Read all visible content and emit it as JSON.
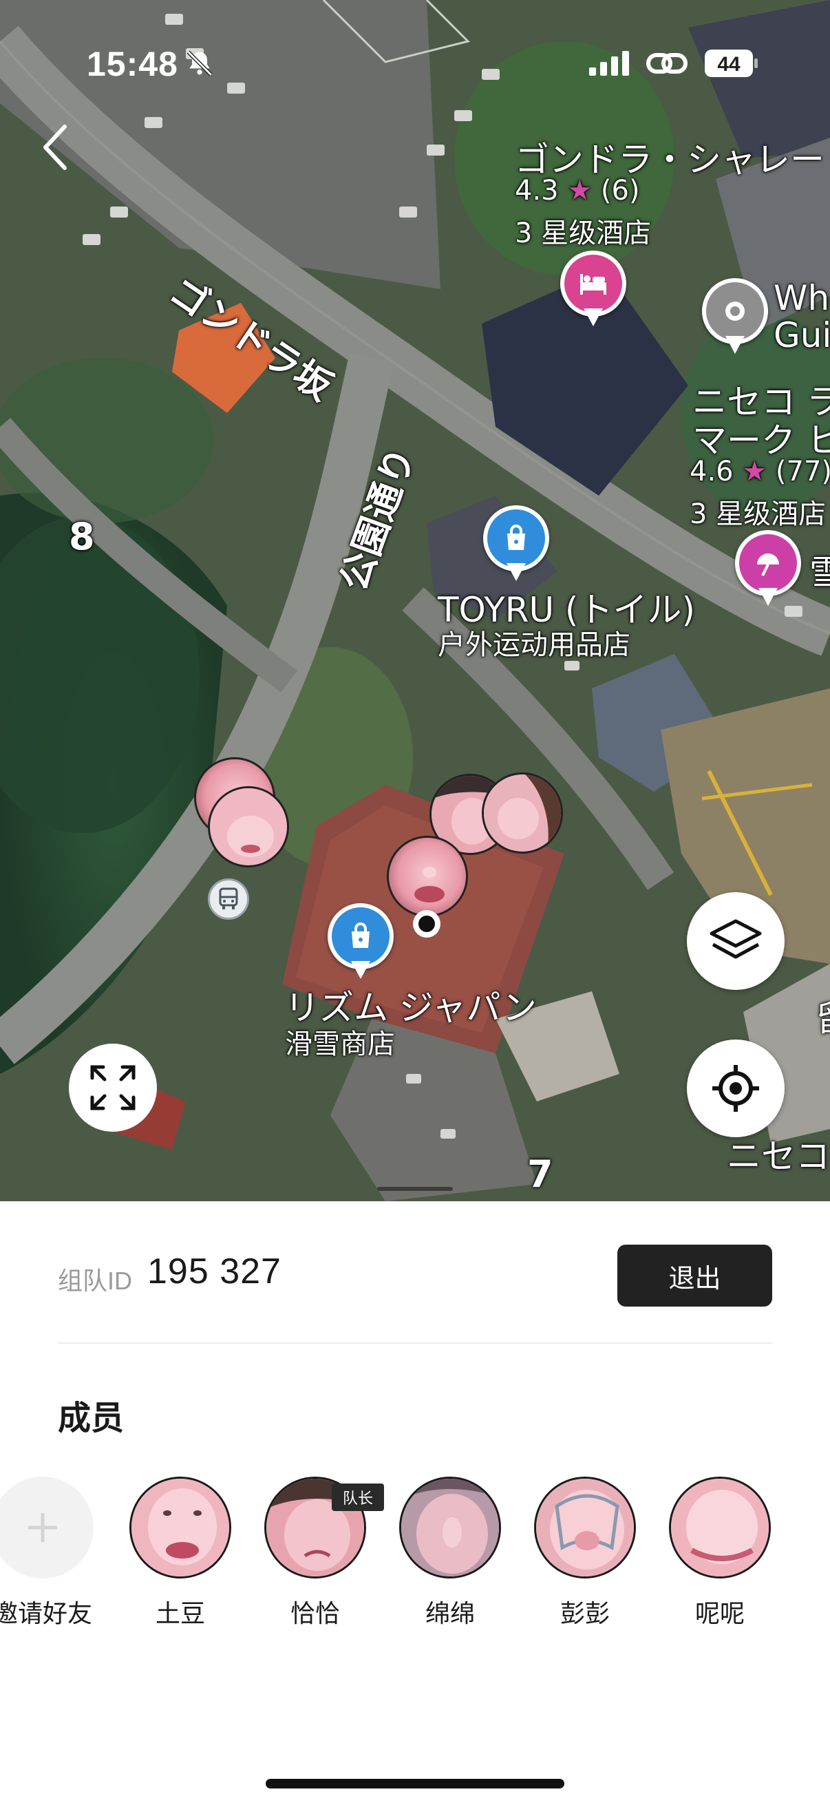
{
  "status_bar": {
    "time": "15:48",
    "battery": "44"
  },
  "map": {
    "labels": {
      "gondola_chalet": "ゴンドラ・シャレー",
      "gondola_rating": "4.3",
      "gondola_reviews": "(6)",
      "gondola_type": "3 星级酒店",
      "gondola_slope": "ゴンドラ坂",
      "wh_title_1": "Wh",
      "wh_title_2": "Gui",
      "niseko_mark_1": "ニセコ ラ",
      "niseko_mark_2": "マーク ヒ",
      "niseko_rating": "4.6",
      "niseko_reviews": "(77)",
      "niseko_type": "3 星级酒店",
      "park_street": "公園通り",
      "toyru_title": "TOYRU (トイル)",
      "toyru_sub": "户外运动用品店",
      "rhythm_title": "リズム ジャパン",
      "rhythm_sub": "滑雪商店",
      "snow_partial": "雪",
      "niseko_partial": "ニセコ",
      "num_8": "8",
      "num_7": "7",
      "misc_left": "留"
    },
    "colors": {
      "hotel_pin": "#d9438f",
      "shop_pin": "#2f8ddb",
      "info_pin": "#8e8e8e",
      "leisure_pin": "#cc3fa6"
    }
  },
  "team": {
    "label": "组队ID",
    "id": "195 327",
    "exit_label": "退出"
  },
  "members": {
    "title": "成员",
    "invite_label": "邀请好友",
    "list": [
      {
        "name": "土豆"
      },
      {
        "name": "恰恰",
        "badge": "队长"
      },
      {
        "name": "绵绵"
      },
      {
        "name": "彭彭"
      },
      {
        "name": "呢呢"
      }
    ]
  }
}
